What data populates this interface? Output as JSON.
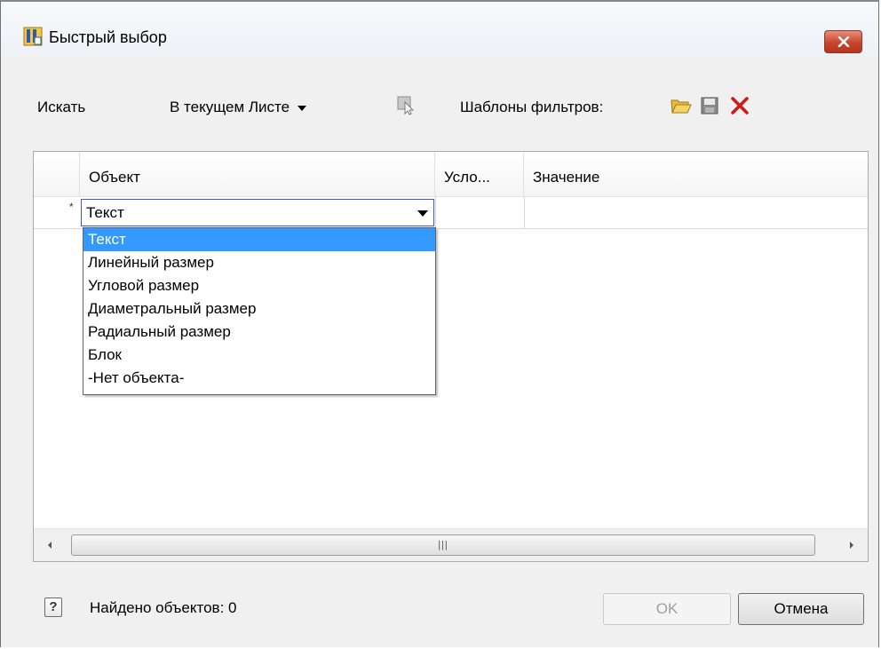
{
  "window": {
    "title": "Быстрый выбор"
  },
  "toolbar": {
    "search_label": "Искать",
    "scope_value": "В текущем Листе",
    "templates_label": "Шаблоны фильтров:"
  },
  "grid": {
    "columns": [
      "Объект",
      "Усло...",
      "Значение"
    ],
    "row_marker": "*",
    "current_value": "Текст",
    "dropdown_options": [
      "Текст",
      "Линейный размер",
      "Угловой размер",
      "Диаметральный размер",
      "Радиальный размер",
      "Блок",
      "-Нет объекта-"
    ],
    "selected_index": 0
  },
  "footer": {
    "help_glyph": "?",
    "status": "Найдено объектов: 0",
    "ok_label": "OK",
    "cancel_label": "Отмена"
  },
  "colors": {
    "selection": "#3399ff",
    "combo_border": "#3f59c9",
    "delete_icon": "#d01a1a",
    "folder_icon": "#f2c94c",
    "close_button": "#c8452d"
  },
  "icons": {
    "app": "quick-select-app-icon",
    "select_objects": "select-objects-icon",
    "open": "folder-open-icon",
    "save": "save-icon",
    "delete": "delete-icon",
    "help": "help-icon"
  }
}
